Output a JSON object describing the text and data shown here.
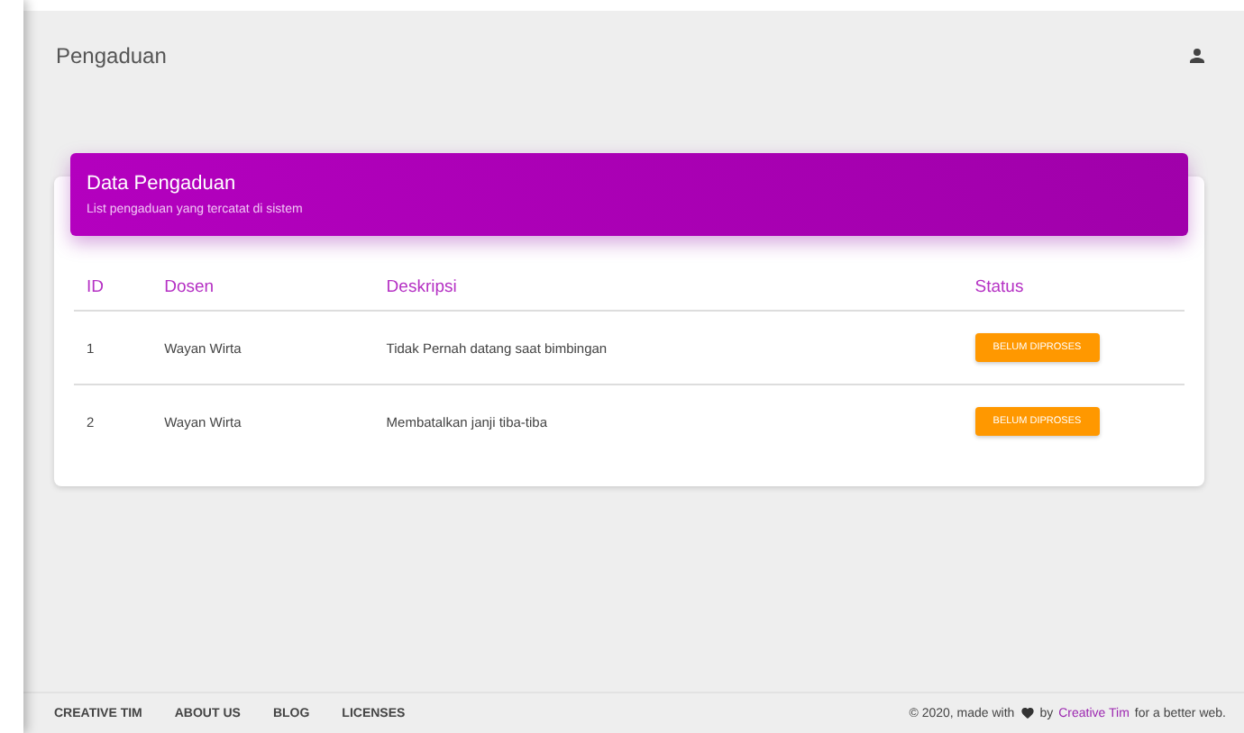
{
  "navbar": {
    "title": "Pengaduan"
  },
  "card": {
    "title": "Data Pengaduan",
    "subtitle": "List pengaduan yang tercatat di sistem",
    "columns": [
      "ID",
      "Dosen",
      "Deskripsi",
      "Status"
    ],
    "rows": [
      {
        "id": "1",
        "dosen": "Wayan Wirta",
        "deskripsi": "Tidak Pernah datang saat bimbingan",
        "status": "BELUM DIPROSES"
      },
      {
        "id": "2",
        "dosen": "Wayan Wirta",
        "deskripsi": "Membatalkan janji tiba-tiba",
        "status": "BELUM DIPROSES"
      }
    ]
  },
  "footer": {
    "links": [
      "CREATIVE TIM",
      "ABOUT US",
      "BLOG",
      "LICENSES"
    ],
    "copyright": "© 2020, made with",
    "by": "by",
    "author": "Creative Tim",
    "tail": "for a better web."
  }
}
